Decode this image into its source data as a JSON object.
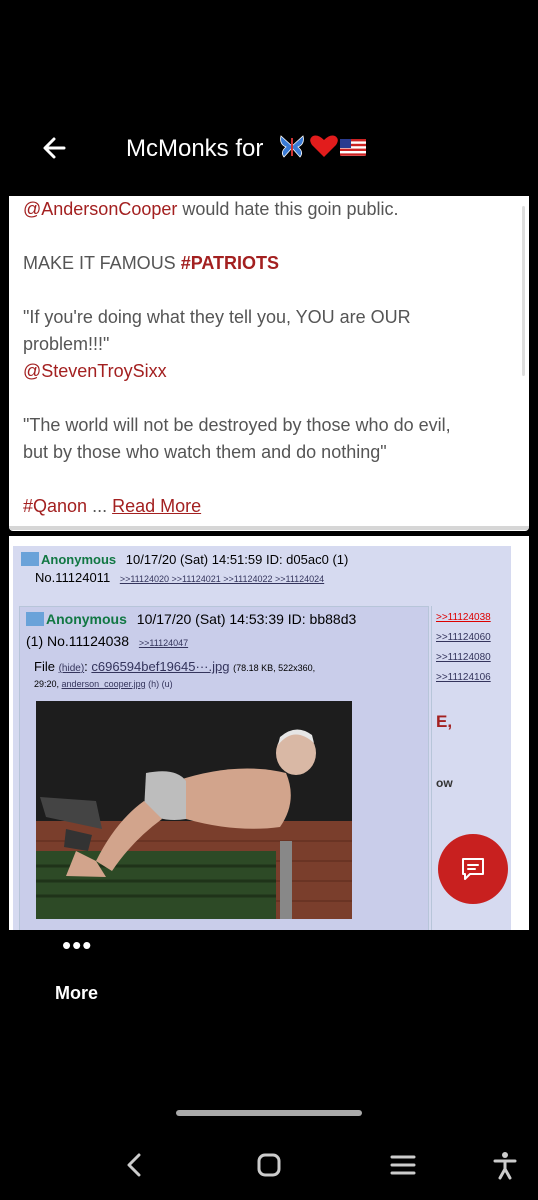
{
  "header": {
    "title": "McMonks for",
    "title_emoji": [
      "butterfly",
      "heart",
      "us-flag"
    ],
    "back_icon": "arrow-left-icon"
  },
  "post": {
    "line1_mention": "@AndersonCooper",
    "line1_rest": " would hate this goin public.",
    "line2_text": "MAKE IT FAMOUS ",
    "line2_hashtag": "#PATRIOTS",
    "quote1_line1": "\"If you're doing what they tell you, YOU are OUR",
    "quote1_line2": "problem!!!\"",
    "quote1_mention": "@StevenTroySixx",
    "quote2_line1": "\"The world will not be destroyed by those who do evil,",
    "quote2_line2": "but by those who watch them and do nothing\"",
    "footer_hashtag": "#Qanon",
    "ellipsis": " ... ",
    "read_more": "Read More"
  },
  "attachment": {
    "post1_name": "Anonymous",
    "post1_meta": "10/17/20 (Sat) 14:51:59 ID: d05ac0 (1)",
    "post1_no": "No.11124011",
    "post1_replies": ">>11124020 >>11124021 >>11124022 >>11124024",
    "post2_name": "Anonymous",
    "post2_meta": "10/17/20 (Sat) 14:53:39 ID: bb88d3",
    "post2_no": "(1) No.11124038",
    "post2_reply": ">>11124047",
    "file_label": "File",
    "file_hide": "(hide)",
    "file_name": "c696594bef19645···.jpg",
    "file_info": "(78.18 KB, 522x360,",
    "file_info2": "29:20,",
    "file_orig": "anderson_cooper.jpg",
    "file_links": "(h) (u)",
    "side_links": [
      ">>11124038",
      ">>11124060",
      ">>11124080",
      ">>11124106"
    ],
    "side_text1": "E,",
    "side_text2": "ow"
  },
  "fab": {
    "icon": "quote-comment-icon"
  },
  "more": {
    "dots": "•••",
    "label": "More"
  },
  "nav": {
    "back_icon": "chevron-left-icon",
    "home_icon": "home-square-icon",
    "recents_icon": "menu-lines-icon",
    "accessibility_icon": "accessibility-icon"
  }
}
